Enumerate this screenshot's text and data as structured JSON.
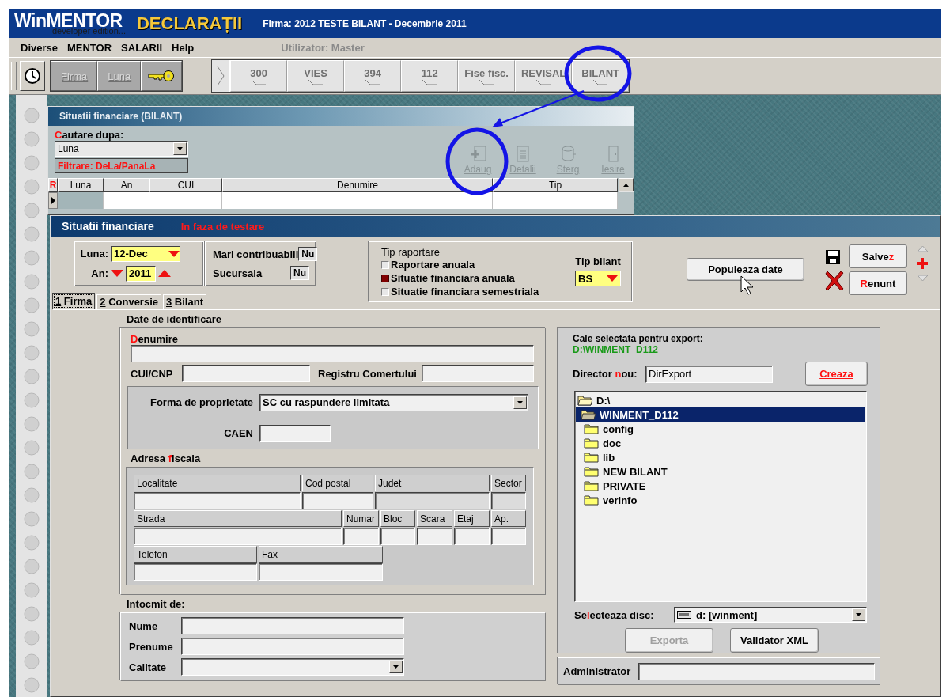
{
  "title_bar": {
    "logo": "WinMENTOR",
    "edition": "developer edition...",
    "product": "DECLARAȚII",
    "company": "Firma: 2012 TESTE BILANT - Decembrie 2011"
  },
  "menu": [
    "Diverse",
    "MENTOR",
    "SALARII",
    "Help"
  ],
  "user": "Utilizator: Master",
  "toolbar": {
    "context_buttons": [
      {
        "label": "Firma",
        "disabled": true
      },
      {
        "label": "Luna",
        "disabled": true
      }
    ],
    "declarations": [
      {
        "label": "300"
      },
      {
        "label": "VIES"
      },
      {
        "label": "394"
      },
      {
        "label": "112"
      },
      {
        "label": "Fise fisc."
      },
      {
        "label": "REVISAL"
      },
      {
        "label": "BILANT"
      }
    ]
  },
  "list_window": {
    "title": "Situatii financiare (BILANT)",
    "search_label": [
      {
        "text": "C",
        "accent": true
      },
      {
        "text": "autare dupa:",
        "accent": false
      }
    ],
    "search_value": "Luna",
    "filter": "Filtrare: DeLa/PanaLa",
    "actions": [
      {
        "kind": "add",
        "label": "Adaug",
        "disabled": true
      },
      {
        "kind": "details",
        "label": "Detalii",
        "disabled": true
      },
      {
        "kind": "delete",
        "label": "Sterg",
        "disabled": true
      },
      {
        "kind": "exit",
        "label": "Iesire",
        "disabled": true
      }
    ],
    "row_marker": "R",
    "columns": [
      "Luna",
      "An",
      "CUI",
      "Denumire",
      "Tip"
    ]
  },
  "form_window": {
    "title": "Situatii financiare",
    "status": "In faza de testare",
    "period": {
      "month_label": "Luna:",
      "month_value": "12-Dec",
      "year_label": "An:",
      "year_value": "2011"
    },
    "flags": [
      {
        "label": "Mari contribuabili",
        "value": "Nu"
      },
      {
        "label": "Sucursala",
        "value": "Nu"
      }
    ],
    "report_type": {
      "title": "Tip raportare",
      "options": [
        {
          "label": "Raportare anuala",
          "selected": false
        },
        {
          "label": "Situatie financiara anuala",
          "selected": true
        },
        {
          "label": "Situatie financiara semestriala",
          "selected": false
        }
      ]
    },
    "balance_type": {
      "label": "Tip bilant",
      "value": "BS"
    },
    "populate_button": "Populeaza date",
    "save_button": [
      {
        "text": "Salve",
        "accent": false
      },
      {
        "text": "z",
        "accent": true
      }
    ],
    "cancel_button": [
      {
        "text": "R",
        "accent": true
      },
      {
        "text": "enunt",
        "accent": false
      }
    ],
    "tabs": [
      {
        "number": "1",
        "label": "Firma",
        "selected": true
      },
      {
        "number": "2",
        "label": "Conversie",
        "selected": false
      },
      {
        "number": "3",
        "label": "Bilant",
        "selected": false
      }
    ],
    "identification": {
      "title": "Date de identificare",
      "name_label": [
        {
          "text": "D",
          "accent": true
        },
        {
          "text": "enumire",
          "accent": false
        }
      ],
      "cui_label": "CUI/CNP",
      "registry_label": "Registru Comertului",
      "ownership_label": "Forma de proprietate",
      "ownership_value": "SC cu raspundere limitata",
      "caen_label": "CAEN"
    },
    "address": {
      "title": [
        {
          "text": "Adresa ",
          "accent": false
        },
        {
          "text": "f",
          "accent": true
        },
        {
          "text": "iscala",
          "accent": false
        }
      ],
      "lines": [
        {
          "fields": [
            {
              "label": "Localitate",
              "disabled": false
            },
            {
              "label": "Cod postal",
              "disabled": false
            },
            {
              "label": "Judet",
              "disabled": true
            },
            {
              "label": "Sector",
              "disabled": true
            }
          ]
        },
        {
          "fields": [
            {
              "label": "Strada",
              "disabled": false
            },
            {
              "label": "Numar",
              "disabled": false
            },
            {
              "label": "Bloc",
              "disabled": false
            },
            {
              "label": "Scara",
              "disabled": false
            },
            {
              "label": "Etaj",
              "disabled": false
            },
            {
              "label": "Ap.",
              "disabled": false
            }
          ]
        },
        {
          "fields": [
            {
              "label": "Telefon",
              "disabled": false
            },
            {
              "label": "Fax",
              "disabled": false
            }
          ]
        }
      ]
    },
    "prepared_by": {
      "title": "Intocmit de:",
      "fields": [
        {
          "label": "Nume",
          "kind": "text"
        },
        {
          "label": "Prenume",
          "kind": "text"
        },
        {
          "label": "Calitate",
          "kind": "dropdown"
        }
      ]
    },
    "export": {
      "path_label": "Cale selectata pentru export:",
      "path": "D:\\WINMENT_D112",
      "dir_label": [
        {
          "text": "Director ",
          "accent": false
        },
        {
          "text": "n",
          "accent": true
        },
        {
          "text": "ou:",
          "accent": false
        }
      ],
      "dir_value": "DirExport",
      "create_button": "Creaza",
      "tree": [
        {
          "label": "D:\\",
          "selected": false,
          "children": [
            {
              "label": "WINMENT_D112",
              "selected": true,
              "children": [
                {
                  "label": "config",
                  "selected": false
                },
                {
                  "label": "doc",
                  "selected": false
                },
                {
                  "label": "lib",
                  "selected": false
                },
                {
                  "label": "NEW BILANT",
                  "selected": false
                },
                {
                  "label": "PRIVATE",
                  "selected": false
                },
                {
                  "label": "verinfo",
                  "selected": false
                }
              ]
            }
          ]
        }
      ],
      "disk_label": [
        {
          "text": "Se",
          "accent": false
        },
        {
          "text": "l",
          "accent": true
        },
        {
          "text": "ecteaza disc:",
          "accent": false
        }
      ],
      "disk_value": "d: [winment]",
      "buttons": [
        {
          "label": "Exporta",
          "disabled": true
        },
        {
          "label": "Validator XML",
          "disabled": false
        }
      ]
    },
    "administrator_label": "Administrator"
  }
}
